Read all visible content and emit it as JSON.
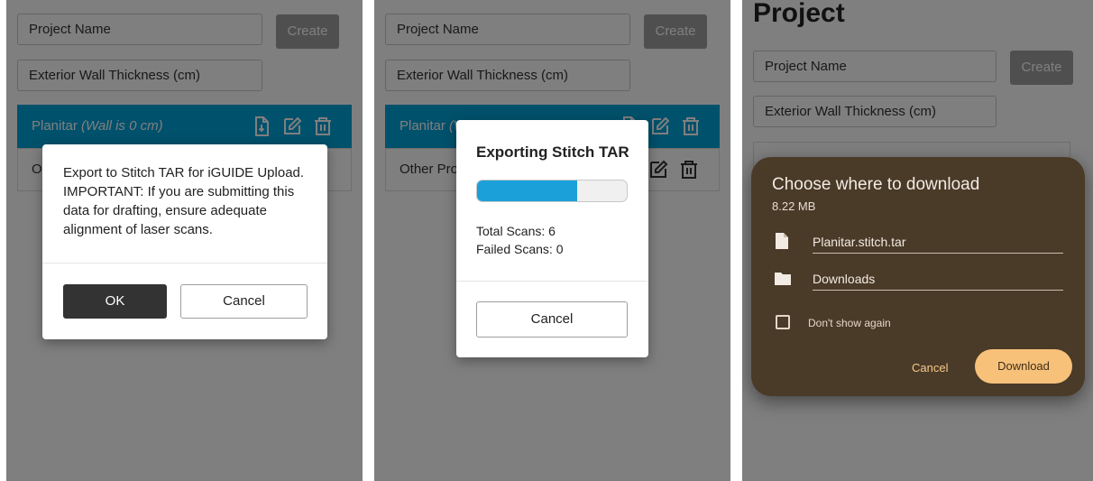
{
  "form": {
    "project_name_placeholder": "Project Name",
    "create_label": "Create",
    "wall_thickness_placeholder": "Exterior Wall Thickness (cm)"
  },
  "projects": [
    {
      "name": "Planitar",
      "note": "(Wall is 0 cm)"
    },
    {
      "name": "Other Pro",
      "note": ""
    }
  ],
  "panel1": {
    "dialog_message": "Export to Stitch TAR for iGUIDE Upload. IMPORTANT: If you are submitting this data for drafting, ensure adequate alignment of laser scans.",
    "ok_label": "OK",
    "cancel_label": "Cancel",
    "behind_row_initial": "O"
  },
  "panel2": {
    "dialog_title": "Exporting Stitch TAR",
    "progress_fraction": 0.67,
    "total_scans": "Total Scans: 6",
    "failed_scans": "Failed Scans: 0",
    "cancel_label": "Cancel"
  },
  "panel3": {
    "page_title": "Project",
    "dialog_title": "Choose where to download",
    "file_size": "8.22 MB",
    "file_name": "Planitar.stitch.tar",
    "folder_name": "Downloads",
    "dont_show_again": "Don't show again",
    "cancel_label": "Cancel",
    "download_label": "Download"
  },
  "icons": [
    "file-export-icon",
    "edit-icon",
    "trash-icon",
    "file-icon",
    "folder-icon"
  ],
  "colors": {
    "accent": "#00a3d9",
    "create_disabled": "#9e9e9e",
    "ok_button": "#333333",
    "android_dialog": "#4a3a28",
    "android_button": "#f7c17a"
  }
}
